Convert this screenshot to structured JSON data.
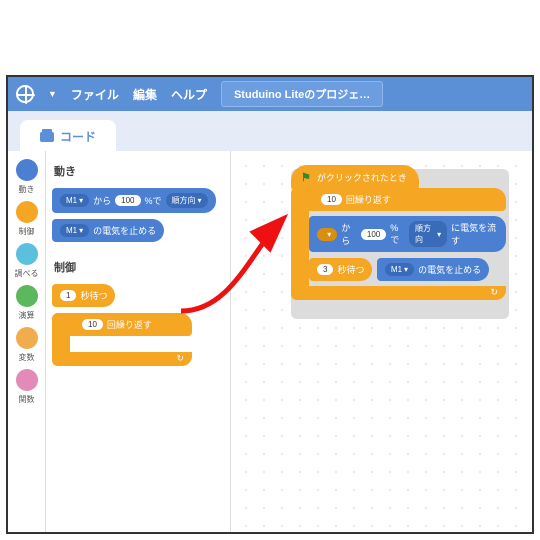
{
  "menu": {
    "file": "ファイル",
    "edit": "編集",
    "help": "ヘルプ",
    "project_title": "Studuino Liteのプロジェ…"
  },
  "tab": {
    "code": "コード"
  },
  "categories": [
    {
      "label": "動き",
      "color": "#4a7fd1"
    },
    {
      "label": "制御",
      "color": "#f5a623"
    },
    {
      "label": "調べる",
      "color": "#5bc0de"
    },
    {
      "label": "演算",
      "color": "#5cb85c"
    },
    {
      "label": "変数",
      "color": "#f0ad4e"
    },
    {
      "label": "関数",
      "color": "#e28bb8"
    }
  ],
  "palette": {
    "motion_header": "動き",
    "motor_run": {
      "port": "M1",
      "from": "から",
      "pct": "100",
      "pct_suffix": "%で",
      "dir": "順方向"
    },
    "motor_stop": {
      "port": "M1",
      "text": "の電気を止める"
    },
    "control_header": "制御",
    "wait": {
      "secs": "1",
      "text": "秒待つ"
    },
    "repeat": {
      "count": "10",
      "text": "回繰り返す"
    }
  },
  "script": {
    "hat": "がクリックされたとき",
    "repeat": {
      "count": "10",
      "text": "回繰り返す"
    },
    "motor_run": {
      "from": "から",
      "pct": "100",
      "pct_suffix": "%で",
      "dir": "順方向",
      "tail": "に電気を流す"
    },
    "wait": {
      "secs": "3",
      "text": "秒待つ"
    },
    "motor_stop": {
      "port": "M1",
      "text": "の電気を止める"
    }
  }
}
